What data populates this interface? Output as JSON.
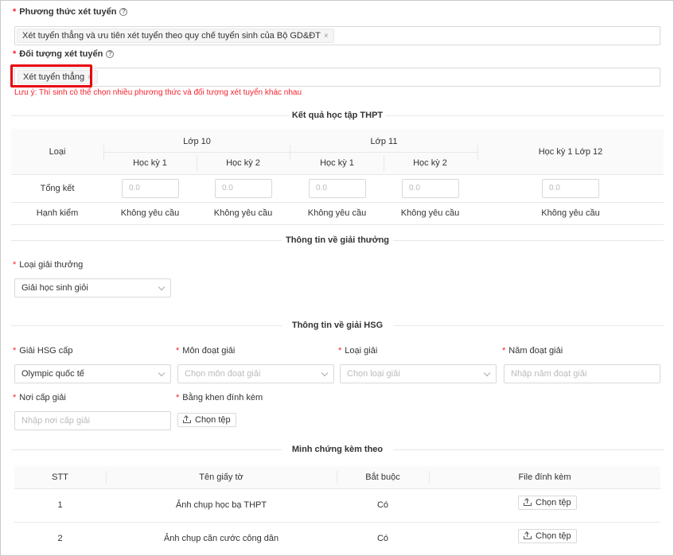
{
  "phuong_thuc": {
    "label": "Phương thức xét tuyển",
    "tag": "Xét tuyển thẳng và ưu tiên xét tuyển theo quy chế tuyển sinh của Bộ GD&ĐT",
    "remove": "×"
  },
  "doi_tuong": {
    "label": "Đối tượng xét tuyển",
    "tag": "Xét tuyển thẳng",
    "remove": "×",
    "note": "Lưu ý: Thí sinh có thể chọn nhiều phương thức và đối tượng xét tuyển khác nhau"
  },
  "help_glyph": "?",
  "required_mark": "*",
  "ket_qua": {
    "title": "Kết quả học tập THPT",
    "col_loai": "Loại",
    "lop10": "Lớp 10",
    "lop11": "Lớp 11",
    "hk1": "Học kỳ 1",
    "hk2": "Học kỳ 2",
    "lop12": "Học kỳ 1 Lớp 12",
    "row_tongket": "Tổng kết",
    "row_hanhkiem": "Hạnh kiểm",
    "score_placeholder": "0.0",
    "conduct_value": "Không yêu cầu"
  },
  "giai_thuong": {
    "title": "Thông tin về giải thưởng",
    "loai_label": "Loại giải thưởng",
    "loai_value": "Giải học sinh giỏi"
  },
  "giai_hsg": {
    "title": "Thông tin về giải HSG",
    "cap_label": "Giải HSG cấp",
    "cap_value": "Olympic quốc tế",
    "mon_label": "Môn đoạt giải",
    "mon_placeholder": "Chọn môn đoạt giải",
    "loai_label": "Loại giải",
    "loai_placeholder": "Chọn loại giải",
    "nam_label": "Năm đoạt giải",
    "nam_placeholder": "Nhập năm đoạt giải",
    "noi_label": "Nơi cấp giải",
    "noi_placeholder": "Nhập nơi cấp giải",
    "bang_label": "Bằng khen đính kèm",
    "upload_label": "Chọn tệp"
  },
  "minh_chung": {
    "title": "Minh chứng kèm theo",
    "headers": [
      "STT",
      "Tên giấy tờ",
      "Bắt buộc",
      "File đính kèm"
    ],
    "rows": [
      {
        "stt": "1",
        "name": "Ảnh chụp học bạ THPT",
        "required": "Có",
        "upload": "Chọn tệp"
      },
      {
        "stt": "2",
        "name": "Ảnh chụp căn cước công dân",
        "required": "Có",
        "upload": "Chọn tệp"
      }
    ]
  },
  "colors": {
    "required": "#f5222d",
    "highlight": "#e8000b",
    "border": "#d9d9d9",
    "table_header_bg": "#fafafa"
  }
}
